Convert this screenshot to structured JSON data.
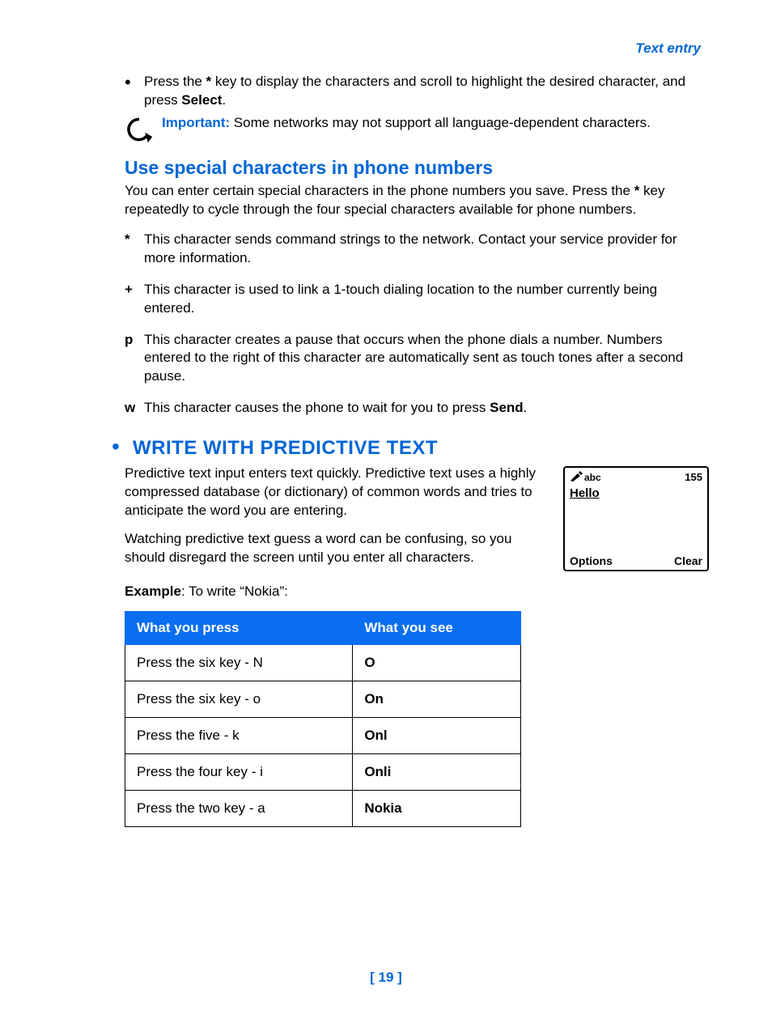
{
  "header": {
    "section": "Text entry"
  },
  "intro_bullet": {
    "pre": "Press the ",
    "key": "*",
    "mid": " key to display the characters and scroll to highlight the desired character, and press ",
    "bold": "Select",
    "post": "."
  },
  "important": {
    "label": "Important:",
    "text": " Some networks may not support all language-dependent characters."
  },
  "special": {
    "heading": "Use special characters in phone numbers",
    "intro_pre": "You can enter certain special characters in the phone numbers you save. Press the ",
    "intro_key": "*",
    "intro_post": " key repeatedly to cycle through the four special characters available for phone numbers.",
    "rows": [
      {
        "k": "*",
        "t": "This character sends command strings to the network. Contact your service provider for more information."
      },
      {
        "k": "+",
        "t": "This character is used to link a 1-touch dialing location to the number currently being entered."
      },
      {
        "k": "p",
        "t": "This character creates a pause that occurs when the phone dials a number. Numbers entered to the right of this character are automatically sent as touch tones after a second pause."
      },
      {
        "k": "w",
        "t_pre": "This character causes the phone to wait for you to press ",
        "t_bold": "Send",
        "t_post": "."
      }
    ]
  },
  "predictive": {
    "heading": "WRITE WITH PREDICTIVE TEXT",
    "p1": "Predictive text input enters text quickly. Predictive text uses a highly compressed database (or dictionary) of common words and tries to anticipate the word you are entering.",
    "p2": "Watching predictive text guess a word can be confusing, so you should disregard the screen until you enter all characters.",
    "example_label": "Example",
    "example_text": ": To write “Nokia”:",
    "phone": {
      "mode": "abc",
      "count": "155",
      "word": "Hello",
      "left": "Options",
      "right": "Clear"
    },
    "table": {
      "h1": "What you press",
      "h2": "What you see",
      "rows": [
        {
          "press": "Press the six key - N",
          "see": "O"
        },
        {
          "press": "Press the six key - o",
          "see": "On"
        },
        {
          "press": "Press the five - k",
          "see": "Onl"
        },
        {
          "press": "Press the four key - i",
          "see": "Onli"
        },
        {
          "press": "Press the two key - a",
          "see": "Nokia"
        }
      ]
    }
  },
  "page_number": "[ 19 ]"
}
